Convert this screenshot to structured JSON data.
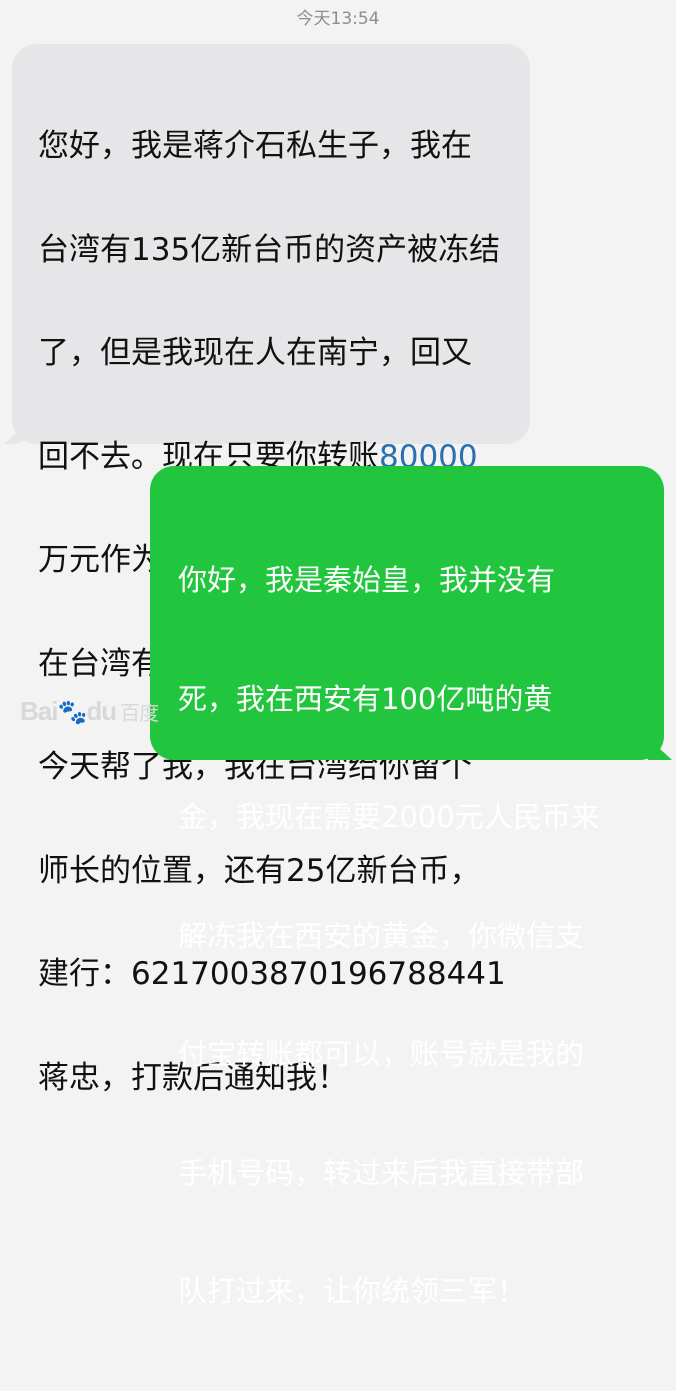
{
  "conversation": {
    "timestamp": "今天13:54",
    "incoming_message": {
      "line_1": "您好，我是蒋介石私生子，我在",
      "line_2": "台湾有135亿新台币的资产被冻结",
      "line_3": "了，但是我现在人在南宁，回又",
      "line_4_before_link": "回不去。现在只要你转账",
      "line_4_link": "80000",
      "line_5": "万元作为流动资金解冻账户，我",
      "line_6": "在台湾有了自己的部队，若是你",
      "line_7": "今天帮了我，我在台湾给你留个",
      "line_8": "师长的位置，还有25亿新台币，",
      "line_9": "建行：6217003870196788441",
      "line_10": "蒋忠，打款后通知我！"
    },
    "outgoing_message": {
      "line_1": "你好，我是秦始皇，我并没有",
      "line_2": "死，我在西安有100亿吨的黄",
      "line_3": "金，我现在需要2000元人民币来",
      "line_4": "解冻我在西安的黄金，你微信支",
      "line_5": "付宝转账都可以，账号就是我的",
      "line_6": "手机号码，转过来后我直接带部",
      "line_7": "队打过来，让你统领三军！"
    }
  },
  "watermark": {
    "text_left": "Bai",
    "text_right": "du",
    "text_cn": "百度"
  },
  "colors": {
    "incoming_bubble": "#e6e6e8",
    "outgoing_bubble": "#21c63e",
    "link": "#2a6fb0"
  }
}
